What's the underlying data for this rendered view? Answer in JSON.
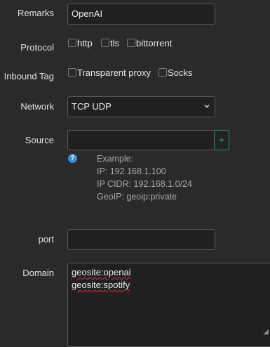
{
  "remarks": {
    "label": "Remarks",
    "value": "OpenAI"
  },
  "protocol": {
    "label": "Protocol",
    "options": [
      {
        "label": "http",
        "checked": false
      },
      {
        "label": "tls",
        "checked": false
      },
      {
        "label": "bittorrent",
        "checked": false
      }
    ]
  },
  "inbound_tag": {
    "label": "Inbound Tag",
    "options": [
      {
        "label": "Transparent proxy",
        "checked": false
      },
      {
        "label": "Socks",
        "checked": false
      }
    ]
  },
  "network": {
    "label": "Network",
    "value": "TCP UDP"
  },
  "source": {
    "label": "Source",
    "value": "",
    "add_label": "+",
    "help_icon": "?",
    "example": [
      "Example:",
      "IP: 192.168.1.100",
      "IP CIDR: 192.168.1.0/24",
      "GeoIP: geoip:private"
    ]
  },
  "port": {
    "label": "port",
    "value": ""
  },
  "domain": {
    "label": "Domain",
    "lines": [
      "geosite:openai",
      "geosite:spotify"
    ]
  }
}
